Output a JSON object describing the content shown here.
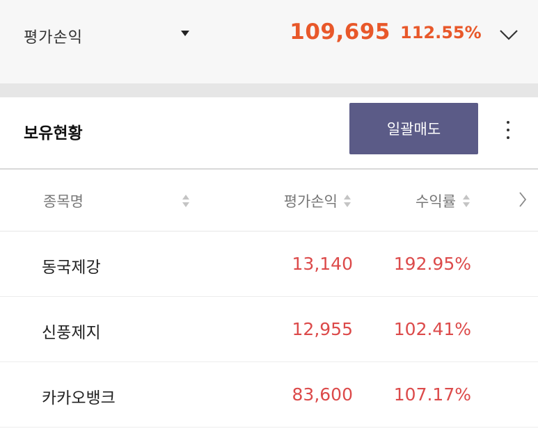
{
  "summary": {
    "label": "평가손익",
    "value": "109,695",
    "rate": "112.55%"
  },
  "holdings": {
    "title": "보유현황",
    "sell_all_label": "일괄매도"
  },
  "table": {
    "columns": [
      "종목명",
      "평가손익",
      "수익률"
    ],
    "rows": [
      {
        "name": "동국제강",
        "pnl": "13,140",
        "rate": "192.95%"
      },
      {
        "name": "신풍제지",
        "pnl": "12,955",
        "rate": "102.41%"
      },
      {
        "name": "카카오뱅크",
        "pnl": "83,600",
        "rate": "107.17%"
      }
    ]
  },
  "colors": {
    "accent": "#e8582a",
    "gain": "#dc4a4a",
    "button": "#5b5b87"
  },
  "icons": {
    "summary_dropdown": "caret-down-icon",
    "summary_expand": "chevron-down-icon",
    "more": "more-vertical-icon",
    "sort": "sort-icon",
    "next": "chevron-right-icon"
  }
}
